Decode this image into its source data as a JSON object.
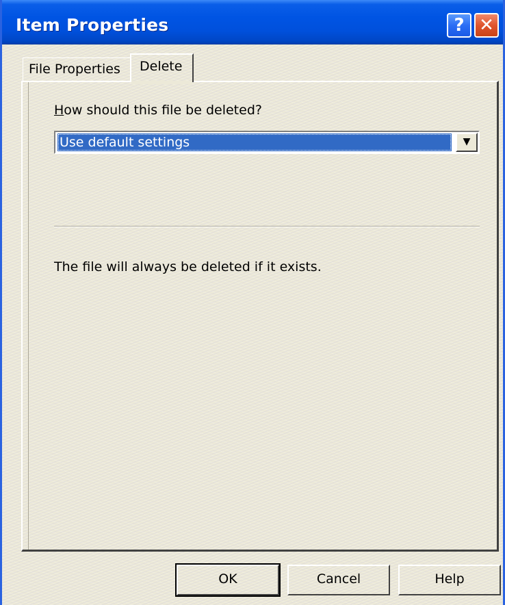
{
  "window": {
    "title": "Item Properties",
    "help_glyph": "?",
    "close_glyph": "✕"
  },
  "tabs": [
    {
      "label": "File Properties",
      "active": false
    },
    {
      "label": "Delete",
      "active": true
    }
  ],
  "delete_tab": {
    "question_underlined_letter": "H",
    "question_rest": "ow should this file be deleted?",
    "selected_option": "Use default settings",
    "dropdown_arrow": "▼",
    "info_text": "The file will always be deleted if it exists."
  },
  "buttons": {
    "ok": "OK",
    "cancel": "Cancel",
    "help": "Help"
  },
  "colors": {
    "titlebar": "#0054e3",
    "selection": "#316ac5",
    "dialog_bg": "#ece9d8",
    "close_button": "#e0552e"
  }
}
